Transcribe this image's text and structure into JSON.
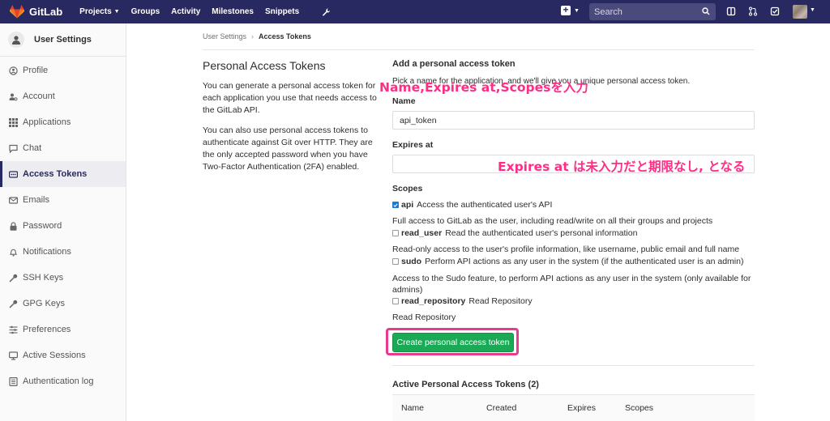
{
  "topnav": {
    "brand": "GitLab",
    "links": [
      "Projects",
      "Groups",
      "Activity",
      "Milestones",
      "Snippets"
    ],
    "search_placeholder": "Search"
  },
  "sidebar": {
    "title": "User Settings",
    "items": [
      {
        "label": "Profile",
        "icon": "profile-icon"
      },
      {
        "label": "Account",
        "icon": "account-icon"
      },
      {
        "label": "Applications",
        "icon": "applications-icon"
      },
      {
        "label": "Chat",
        "icon": "chat-icon"
      },
      {
        "label": "Access Tokens",
        "icon": "access-tokens-icon",
        "active": true
      },
      {
        "label": "Emails",
        "icon": "email-icon"
      },
      {
        "label": "Password",
        "icon": "lock-icon"
      },
      {
        "label": "Notifications",
        "icon": "bell-icon"
      },
      {
        "label": "SSH Keys",
        "icon": "key-icon"
      },
      {
        "label": "GPG Keys",
        "icon": "key-icon"
      },
      {
        "label": "Preferences",
        "icon": "preferences-icon"
      },
      {
        "label": "Active Sessions",
        "icon": "monitor-icon"
      },
      {
        "label": "Authentication log",
        "icon": "log-icon"
      }
    ]
  },
  "breadcrumb": {
    "parent": "User Settings",
    "current": "Access Tokens"
  },
  "intro": {
    "title": "Personal Access Tokens",
    "p1": "You can generate a personal access token for each application you use that needs access to the GitLab API.",
    "p2": "You can also use personal access tokens to authenticate against Git over HTTP. They are the only accepted password when you have Two-Factor Authentication (2FA) enabled."
  },
  "form": {
    "heading": "Add a personal access token",
    "help": "Pick a name for the application, and we'll give you a unique personal access token.",
    "name_label": "Name",
    "name_value": "api_token",
    "expires_label": "Expires at",
    "expires_value": "",
    "scopes_label": "Scopes",
    "scopes": [
      {
        "name": "api",
        "desc": "Access the authenticated user's API",
        "checked": true,
        "detail": "Full access to GitLab as the user, including read/write on all their groups and projects"
      },
      {
        "name": "read_user",
        "desc": "Read the authenticated user's personal information",
        "checked": false,
        "detail": "Read-only access to the user's profile information, like username, public email and full name"
      },
      {
        "name": "sudo",
        "desc": "Perform API actions as any user in the system (if the authenticated user is an admin)",
        "checked": false,
        "detail": "Access to the Sudo feature, to perform API actions as any user in the system (only available for admins)"
      },
      {
        "name": "read_repository",
        "desc": "Read Repository",
        "checked": false,
        "detail": "Read Repository"
      }
    ],
    "submit_label": "Create personal access token"
  },
  "active_tokens": {
    "heading": "Active Personal Access Tokens (2)",
    "columns": [
      "Name",
      "Created",
      "Expires",
      "Scopes"
    ]
  },
  "annotations": {
    "top": "Name,Expires at,Scopesを入力",
    "expires": "Expires at は未入力だと期限なし, となる"
  },
  "colors": {
    "nav": "#292961",
    "accent": "#1aaa55",
    "annotation": "#ff2d86"
  }
}
